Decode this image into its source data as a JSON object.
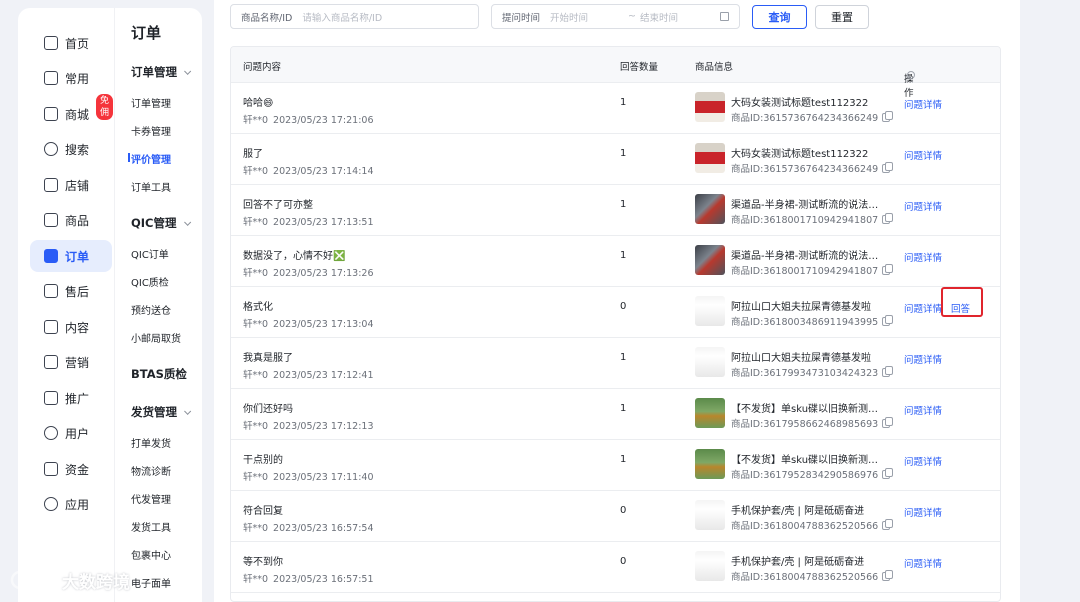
{
  "nav": {
    "items": [
      {
        "label": "首页",
        "icon": "home-icon"
      },
      {
        "label": "常用",
        "icon": "folder-icon"
      },
      {
        "label": "商城",
        "icon": "store-icon",
        "badge": "免佣"
      },
      {
        "label": "搜索",
        "icon": "search-icon"
      },
      {
        "label": "店铺",
        "icon": "shop-icon"
      },
      {
        "label": "商品",
        "icon": "product-icon"
      },
      {
        "label": "订单",
        "icon": "order-icon",
        "active": true
      },
      {
        "label": "售后",
        "icon": "after-sale-icon"
      },
      {
        "label": "内容",
        "icon": "content-icon"
      },
      {
        "label": "营销",
        "icon": "megaphone-icon"
      },
      {
        "label": "推广",
        "icon": "promote-icon"
      },
      {
        "label": "用户",
        "icon": "user-icon"
      },
      {
        "label": "资金",
        "icon": "wallet-icon"
      },
      {
        "label": "应用",
        "icon": "apps-icon"
      }
    ]
  },
  "subnav": {
    "title": "订单",
    "groups": [
      {
        "label": "订单管理",
        "items": [
          "订单管理",
          "卡券管理",
          "评价管理",
          "订单工具"
        ]
      },
      {
        "label": "QIC管理",
        "items": [
          "QIC订单",
          "QIC质检",
          "预约送仓",
          "小邮局取货"
        ]
      },
      {
        "label": "BTAS质检",
        "items": []
      },
      {
        "label": "发货管理",
        "items": [
          "打单发货",
          "物流诊断",
          "代发管理",
          "发货工具",
          "包裹中心",
          "电子面单"
        ]
      }
    ],
    "active_item": "评价管理"
  },
  "filters": {
    "product_label": "商品名称/ID",
    "product_placeholder": "请输入商品名称/ID",
    "time_label": "提问时间",
    "time_start_placeholder": "开始时间",
    "time_separator": "~",
    "time_end_placeholder": "结束时间",
    "search_button": "查询",
    "reset_button": "重置"
  },
  "table": {
    "columns": [
      "问题内容",
      "回答数量",
      "商品信息",
      "操作"
    ],
    "detail_label": "问题详情",
    "answer_label": "回答",
    "rows": [
      {
        "question": "哈哈😄",
        "user": "轩**0",
        "time": "2023/05/23 17:21:06",
        "answers": "1",
        "product": "大码女装测试标题test112322",
        "product_id": "商品ID:3615736764234366249",
        "thumb": "red"
      },
      {
        "question": "服了",
        "user": "轩**0",
        "time": "2023/05/23 17:14:14",
        "answers": "1",
        "product": "大码女装测试标题test112322",
        "product_id": "商品ID:3615736764234366249",
        "thumb": "red"
      },
      {
        "question": "回答不了可亦整",
        "user": "轩**0",
        "time": "2023/05/23 17:13:51",
        "answers": "1",
        "product": "渠道品-半身裙-测试断流的说法色...",
        "product_id": "商品ID:3618001710942941807",
        "thumb": "dark"
      },
      {
        "question": "数据没了，心情不好❎",
        "user": "轩**0",
        "time": "2023/05/23 17:13:26",
        "answers": "1",
        "product": "渠道品-半身裙-测试断流的说法色...",
        "product_id": "商品ID:3618001710942941807",
        "thumb": "dark"
      },
      {
        "question": "格式化",
        "user": "轩**0",
        "time": "2023/05/23 17:13:04",
        "answers": "0",
        "product": "阿拉山口大姐夫拉屎青德基发啦",
        "product_id": "商品ID:3618003486911943995",
        "thumb": "white",
        "show_answer": true
      },
      {
        "question": "我真是服了",
        "user": "轩**0",
        "time": "2023/05/23 17:12:41",
        "answers": "1",
        "product": "阿拉山口大姐夫拉屎青德基发啦",
        "product_id": "商品ID:3617993473103424323",
        "thumb": "white"
      },
      {
        "question": "你们还好吗",
        "user": "轩**0",
        "time": "2023/05/23 17:12:13",
        "answers": "1",
        "product": "【不发货】单sku碟以旧换新测试渠...",
        "product_id": "商品ID:3617958662468985693",
        "thumb": "green"
      },
      {
        "question": "干点别的",
        "user": "轩**0",
        "time": "2023/05/23 17:11:40",
        "answers": "1",
        "product": "【不发货】单sku碟以旧换新测试渠...",
        "product_id": "商品ID:3617952834290586976",
        "thumb": "green"
      },
      {
        "question": "符合回复",
        "user": "轩**0",
        "time": "2023/05/23 16:57:54",
        "answers": "0",
        "product": "手机保护套/壳 | 阿是砥砺奋进",
        "product_id": "商品ID:3618004788362520566",
        "thumb": "white"
      },
      {
        "question": "等不到你",
        "user": "轩**0",
        "time": "2023/05/23 16:57:51",
        "answers": "0",
        "product": "手机保护套/壳 | 阿是砥砺奋进",
        "product_id": "商品ID:3618004788362520566",
        "thumb": "white"
      }
    ]
  },
  "watermark": {
    "text": "大数跨境"
  },
  "colors": {
    "accent": "#2a5cf6",
    "highlight_border": "#e0252d",
    "badge": "#f5343b"
  }
}
